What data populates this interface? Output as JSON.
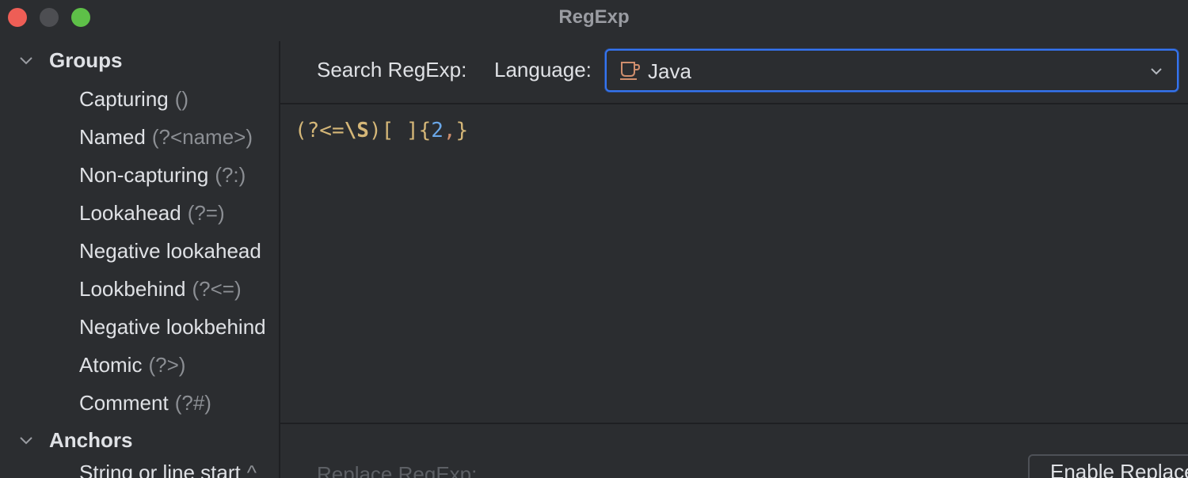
{
  "window": {
    "title": "RegExp",
    "controls": [
      "close",
      "minimize",
      "maximize"
    ]
  },
  "tree": {
    "groups": [
      {
        "label": "Groups",
        "expanded": true,
        "items": [
          {
            "label": "Capturing",
            "hint": "()"
          },
          {
            "label": "Named",
            "hint": "(?<name>)"
          },
          {
            "label": "Non-capturing",
            "hint": "(?:)"
          },
          {
            "label": "Lookahead",
            "hint": "(?=)"
          },
          {
            "label": "Negative lookahead",
            "hint": ""
          },
          {
            "label": "Lookbehind",
            "hint": "(?<=)"
          },
          {
            "label": "Negative lookbehind",
            "hint": ""
          },
          {
            "label": "Atomic",
            "hint": "(?>)"
          },
          {
            "label": "Comment",
            "hint": "(?#)"
          }
        ]
      },
      {
        "label": "Anchors",
        "expanded": true,
        "items": [
          {
            "label": "String or line start",
            "hint": "^"
          }
        ]
      }
    ]
  },
  "search": {
    "label": "Search RegExp:",
    "language_label": "Language:",
    "language_value": "Java",
    "language_icon": "java-cup-icon",
    "regex_tokens": [
      {
        "text": "(?<=",
        "style": "orange"
      },
      {
        "text": "\\S",
        "style": "yellow-bold"
      },
      {
        "text": ")",
        "style": "orange"
      },
      {
        "text": "[ ]",
        "style": "yellow"
      },
      {
        "text": "{",
        "style": "yellow"
      },
      {
        "text": "2",
        "style": "blue"
      },
      {
        "text": ",",
        "style": "orange"
      },
      {
        "text": "}",
        "style": "yellow"
      }
    ]
  },
  "replace": {
    "label": "Replace RegExp:",
    "enable_button": "Enable Replace"
  },
  "colors": {
    "accent": "#3574f0",
    "background": "#2b2d30",
    "close": "#ee5e56",
    "maximize": "#5ec048"
  }
}
